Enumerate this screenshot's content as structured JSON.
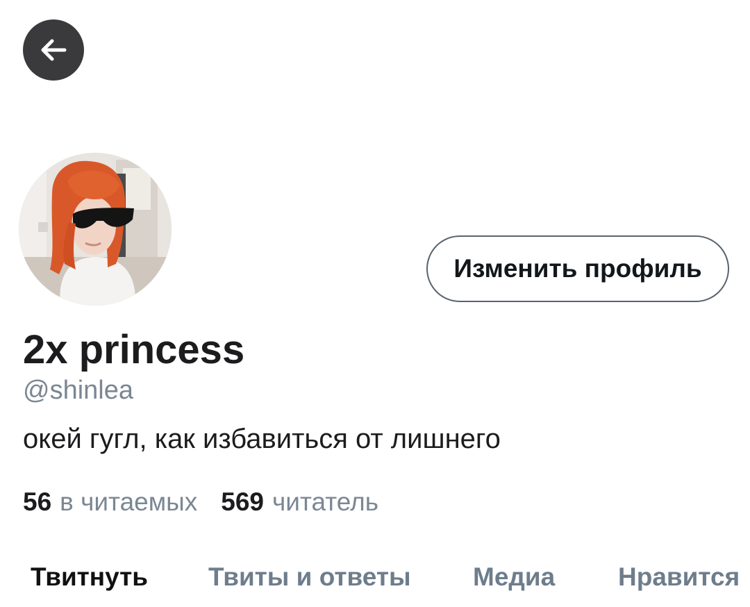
{
  "header": {
    "back_icon": "arrow-left-icon"
  },
  "profile": {
    "avatar_alt": "avatar",
    "edit_button_label": "Изменить профиль",
    "display_name": "2x princess",
    "handle": "@shinlea",
    "bio": "окей гугл, как избавиться от лишнего"
  },
  "stats": {
    "following_count": "56",
    "following_label": "в читаемых",
    "followers_count": "569",
    "followers_label": "читатель"
  },
  "tabs": [
    {
      "label": "Твитнуть",
      "active": true
    },
    {
      "label": "Твиты и ответы",
      "active": false
    },
    {
      "label": "Медиа",
      "active": false
    },
    {
      "label": "Нравится",
      "active": false
    }
  ],
  "colors": {
    "back_button_bg": "#3a3a3c",
    "muted_text": "#7b8793",
    "tab_inactive": "#6e7d8c",
    "primary_text": "#1c1c1e"
  }
}
